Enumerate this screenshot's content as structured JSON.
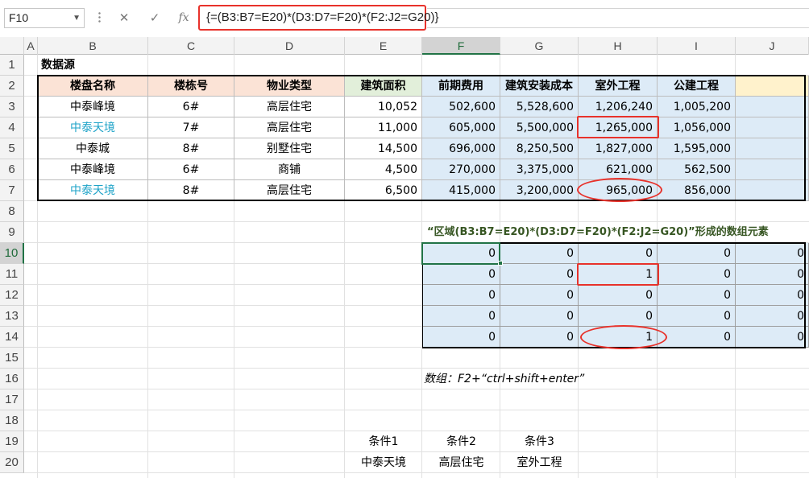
{
  "formula_bar": {
    "name_box": "F10",
    "cancel_icon": "✕",
    "enter_icon": "✓",
    "fx_label": "fx",
    "formula": "{=(B3:B7=E20)*(D3:D7=F20)*(F2:J2=G20)}"
  },
  "columns": [
    "A",
    "B",
    "C",
    "D",
    "E",
    "F",
    "G",
    "H",
    "I",
    "J"
  ],
  "rows": [
    "1",
    "2",
    "3",
    "4",
    "5",
    "6",
    "7",
    "8",
    "9",
    "10",
    "11",
    "12",
    "13",
    "14",
    "15",
    "16",
    "17",
    "18",
    "19",
    "20"
  ],
  "selected_cell": {
    "column": "F",
    "row": "10"
  },
  "source_title": "数据源",
  "table": {
    "headers": [
      "楼盘名称",
      "楼栋号",
      "物业类型",
      "建筑面积",
      "前期费用",
      "建筑安装成本",
      "室外工程",
      "公建工程",
      ""
    ],
    "rows": [
      [
        "中泰峰境",
        "6#",
        "高层住宅",
        "10,052",
        "502,600",
        "5,528,600",
        "1,206,240",
        "1,005,200",
        ""
      ],
      [
        "中泰天境",
        "7#",
        "高层住宅",
        "11,000",
        "605,000",
        "5,500,000",
        "1,265,000",
        "1,056,000",
        ""
      ],
      [
        "中泰城",
        "8#",
        "别墅住宅",
        "14,500",
        "696,000",
        "8,250,500",
        "1,827,000",
        "1,595,000",
        ""
      ],
      [
        "中泰峰境",
        "6#",
        "商铺",
        "4,500",
        "270,000",
        "3,375,000",
        "621,000",
        "562,500",
        ""
      ],
      [
        "中泰天境",
        "8#",
        "高层住宅",
        "6,500",
        "415,000",
        "3,200,000",
        "965,000",
        "856,000",
        ""
      ]
    ]
  },
  "array_caption": "“区域(B3:B7=E20)*(D3:D7=F20)*(F2:J2=G20)”形成的数组元素",
  "array": [
    [
      "0",
      "0",
      "0",
      "0",
      "0"
    ],
    [
      "0",
      "0",
      "1",
      "0",
      "0"
    ],
    [
      "0",
      "0",
      "0",
      "0",
      "0"
    ],
    [
      "0",
      "0",
      "0",
      "0",
      "0"
    ],
    [
      "0",
      "0",
      "1",
      "0",
      "0"
    ]
  ],
  "note": "数组：F2+“ctrl+shift+enter”",
  "criteria": {
    "labels": [
      "条件1",
      "条件2",
      "条件3"
    ],
    "values": [
      "中泰天境",
      "高层住宅",
      "室外工程"
    ]
  },
  "colors": {
    "highlight_red": "#e8322b",
    "cyan_text": "#1ea3c8",
    "header_pink": "#fbe3d6",
    "header_green": "#e2efda",
    "header_yellow": "#fff2cc",
    "cell_blue": "#ddebf7",
    "excel_green": "#217346"
  }
}
